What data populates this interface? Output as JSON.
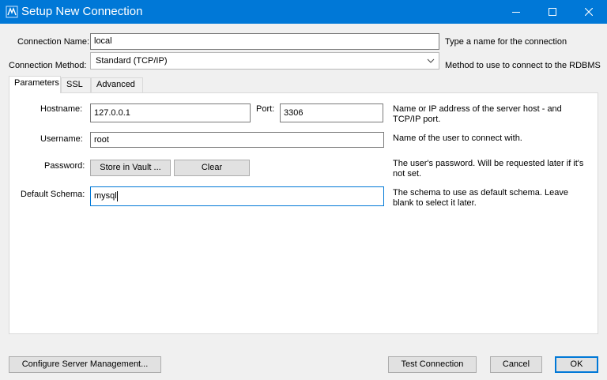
{
  "window": {
    "title": "Setup New Connection"
  },
  "connection": {
    "name_label": "Connection Name:",
    "name_value": "local",
    "name_hint": "Type a name for the connection",
    "method_label": "Connection Method:",
    "method_value": "Standard (TCP/IP)",
    "method_hint": "Method to use to connect to the RDBMS"
  },
  "tabs": [
    {
      "label": "Parameters",
      "active": true
    },
    {
      "label": "SSL"
    },
    {
      "label": "Advanced"
    }
  ],
  "parameters": {
    "hostname_label": "Hostname:",
    "hostname_value": "127.0.0.1",
    "port_label": "Port:",
    "port_value": "3306",
    "hostname_hint_1": "Name or IP address of the server host - and",
    "hostname_hint_2": "TCP/IP port.",
    "username_label": "Username:",
    "username_value": "root",
    "username_hint": "Name of the user to connect with.",
    "password_label": "Password:",
    "store_vault_label": "Store in Vault ...",
    "clear_label": "Clear",
    "password_hint_1": "The user's password. Will be requested later if it's",
    "password_hint_2": "not set.",
    "schema_label": "Default Schema:",
    "schema_value": "mysql",
    "schema_hint_1": "The schema to use as default schema. Leave",
    "schema_hint_2": "blank to select it later."
  },
  "footer": {
    "configure_label": "Configure Server Management...",
    "test_label": "Test Connection",
    "cancel_label": "Cancel",
    "ok_label": "OK"
  },
  "colors": {
    "titlebar": "#0078d7",
    "accent": "#0078d7"
  }
}
